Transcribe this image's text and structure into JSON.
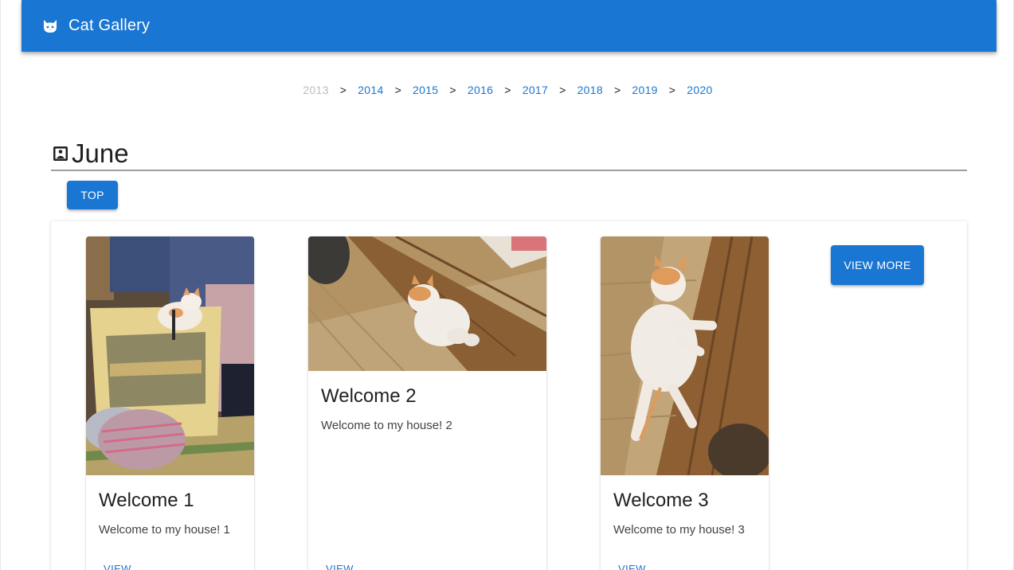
{
  "app": {
    "title": "Cat Gallery",
    "icon": "cat-icon",
    "brand_color": "#1976d2"
  },
  "years": [
    {
      "label": "2013",
      "disabled": true
    },
    {
      "label": "2014"
    },
    {
      "label": "2015"
    },
    {
      "label": "2016"
    },
    {
      "label": "2017"
    },
    {
      "label": "2018"
    },
    {
      "label": "2019"
    },
    {
      "label": "2020"
    }
  ],
  "year_separator": ">",
  "month": {
    "label": "June",
    "icon": "image-icon"
  },
  "top_button": "TOP",
  "view_more_button": "VIEW MORE",
  "cards": [
    {
      "title": "Welcome 1",
      "text": "Welcome to my house! 1",
      "action": "VIEW",
      "photo": "kitten-on-bag-photo"
    },
    {
      "title": "Welcome 2",
      "text": "Welcome to my house! 2",
      "action": "VIEW",
      "photo": "kitten-on-tatami-photo"
    },
    {
      "title": "Welcome 3",
      "text": "Welcome to my house! 3",
      "action": "VIEW",
      "photo": "kitten-on-floor-photo"
    }
  ]
}
